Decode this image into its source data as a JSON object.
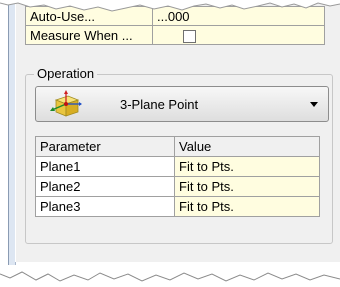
{
  "properties": {
    "rows": [
      {
        "label": "Auto-Use...",
        "value": "...000"
      },
      {
        "label": "Measure When ..."
      }
    ]
  },
  "operation": {
    "group_label": "Operation",
    "selected": "3-Plane Point",
    "icon": "3-plane-point-icon"
  },
  "parameters": {
    "headers": [
      "Parameter",
      "Value"
    ],
    "rows": [
      {
        "name": "Plane1",
        "value": "Fit to Pts."
      },
      {
        "name": "Plane2",
        "value": "Fit to Pts."
      },
      {
        "name": "Plane3",
        "value": "Fit to Pts."
      }
    ]
  }
}
